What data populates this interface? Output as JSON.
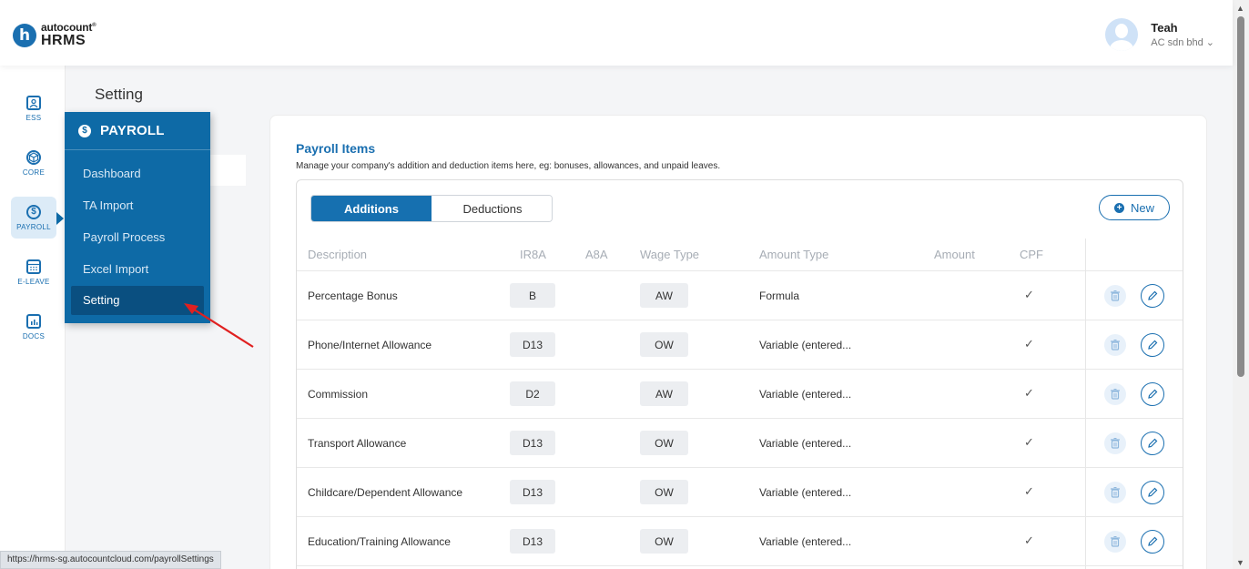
{
  "brand": {
    "top": "autocount",
    "trademark": "®",
    "bottom": "HRMS"
  },
  "user": {
    "name": "Teah",
    "company": "AC sdn bhd",
    "chevron": "⌄"
  },
  "rail": [
    {
      "label": "ESS",
      "icon": "ess-icon"
    },
    {
      "label": "CORE",
      "icon": "core-icon"
    },
    {
      "label": "PAYROLL",
      "icon": "payroll-icon",
      "active": true
    },
    {
      "label": "E-LEAVE",
      "icon": "calendar-icon"
    },
    {
      "label": "DOCS",
      "icon": "docs-icon"
    }
  ],
  "page": {
    "title": "Setting"
  },
  "flyout": {
    "title": "PAYROLL",
    "items": [
      "Dashboard",
      "TA Import",
      "Payroll Process",
      "Excel Import",
      "Setting"
    ],
    "active": "Setting"
  },
  "card": {
    "title": "Payroll Items",
    "subtitle": "Manage your company's addition and deduction items here, eg: bonuses, allowances, and unpaid leaves.",
    "tabs": [
      "Additions",
      "Deductions"
    ],
    "active_tab": "Additions",
    "new_label": "New"
  },
  "table": {
    "headers": [
      "Description",
      "IR8A",
      "A8A",
      "Wage Type",
      "Amount Type",
      "Amount",
      "CPF"
    ],
    "rows": [
      {
        "description": "Percentage Bonus",
        "ir8a": "B",
        "wage": "AW",
        "amount_type": "Formula",
        "cpf": "✓"
      },
      {
        "description": "Phone/Internet Allowance",
        "ir8a": "D13",
        "wage": "OW",
        "amount_type": "Variable (entered...",
        "cpf": "✓"
      },
      {
        "description": "Commission",
        "ir8a": "D2",
        "wage": "AW",
        "amount_type": "Variable (entered...",
        "cpf": "✓"
      },
      {
        "description": "Transport Allowance",
        "ir8a": "D13",
        "wage": "OW",
        "amount_type": "Variable (entered...",
        "cpf": "✓"
      },
      {
        "description": "Childcare/Dependent Allowance",
        "ir8a": "D13",
        "wage": "OW",
        "amount_type": "Variable (entered...",
        "cpf": "✓"
      },
      {
        "description": "Education/Training Allowance",
        "ir8a": "D13",
        "wage": "OW",
        "amount_type": "Variable (entered...",
        "cpf": "✓"
      }
    ]
  },
  "status_url": "https://hrms-sg.autocountcloud.com/payrollSettings",
  "colors": {
    "primary": "#1a6fb0",
    "flyout": "#0e6aa6",
    "flyout_active": "#0a4f80",
    "arrow": "#e02020"
  }
}
